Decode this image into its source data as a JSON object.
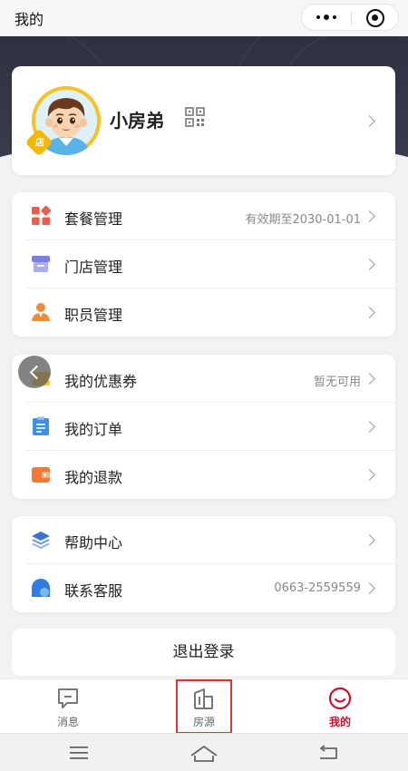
{
  "topbar": {
    "title": "我的",
    "more_icon": "more-dots-icon",
    "close_icon": "target-icon"
  },
  "profile": {
    "name": "小房弟",
    "badge": "店",
    "qr_icon": "qr-code-icon"
  },
  "group1": [
    {
      "label": "套餐管理",
      "value": "有效期至2030-01-01",
      "icon": "grid-icon",
      "color": "#ee5d4a"
    },
    {
      "label": "门店管理",
      "value": "",
      "icon": "store-icon",
      "color": "#7b7fe8"
    },
    {
      "label": "职员管理",
      "value": "",
      "icon": "staff-icon",
      "color": "#f28a36"
    }
  ],
  "group2": [
    {
      "label": "我的优惠券",
      "value": "暂无可用",
      "icon": "coupon-icon",
      "color": "#f5c22c"
    },
    {
      "label": "我的订单",
      "value": "",
      "icon": "order-icon",
      "color": "#3d8fe8"
    },
    {
      "label": "我的退款",
      "value": "",
      "icon": "wallet-icon",
      "color": "#f07a35"
    }
  ],
  "group3": [
    {
      "label": "帮助中心",
      "value": "",
      "icon": "layers-icon",
      "color": "#3a72d9"
    },
    {
      "label": "联系客服",
      "value": "0663-2559559",
      "icon": "service-icon",
      "color": "#2f7de0"
    }
  ],
  "logout_label": "退出登录",
  "tabs": [
    {
      "label": "消息",
      "icon": "message-icon"
    },
    {
      "label": "房源",
      "icon": "building-icon"
    },
    {
      "label": "我的",
      "icon": "smile-icon",
      "active": true
    }
  ],
  "colors": {
    "accent": "#c8102e",
    "header_bg": "#2e3140"
  }
}
